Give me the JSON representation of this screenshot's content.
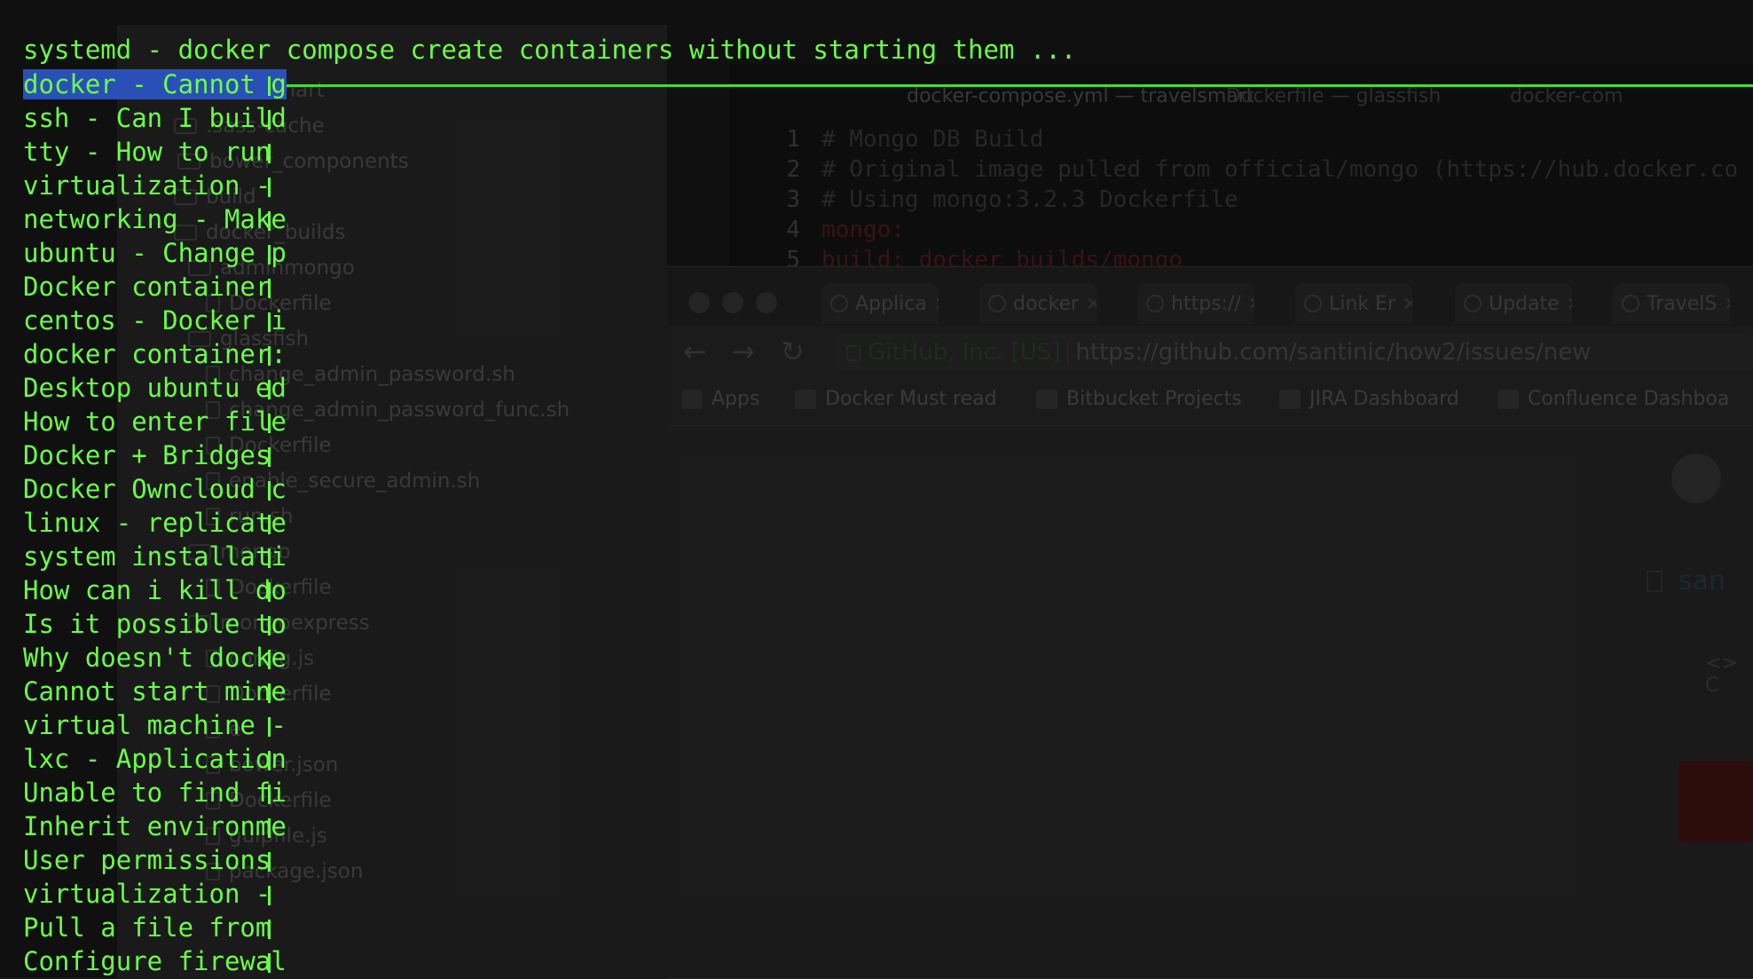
{
  "sidebar": {
    "items": [
      {
        "label": "travelsmart",
        "type": "folder"
      },
      {
        "label": ".sass-cache",
        "type": "folder"
      },
      {
        "label": "bower_components",
        "type": "folder"
      },
      {
        "label": "build",
        "type": "folder"
      },
      {
        "label": "docker_builds",
        "type": "folder"
      },
      {
        "label": "adminmongo",
        "type": "folder"
      },
      {
        "label": "Dockerfile",
        "type": "file"
      },
      {
        "label": "glassfish",
        "type": "folder"
      },
      {
        "label": "change_admin_password.sh",
        "type": "file"
      },
      {
        "label": "change_admin_password_func.sh",
        "type": "file"
      },
      {
        "label": "Dockerfile",
        "type": "file"
      },
      {
        "label": "enable_secure_admin.sh",
        "type": "file"
      },
      {
        "label": "run.sh",
        "type": "file"
      },
      {
        "label": "mongo",
        "type": "folder"
      },
      {
        "label": "Dockerfile",
        "type": "file"
      },
      {
        "label": "mongoexpress",
        "type": "folder"
      },
      {
        "label": "config.js",
        "type": "file"
      },
      {
        "label": "Dockerfile",
        "type": "file"
      },
      {
        "label": "e",
        "type": "file"
      },
      {
        "label": "bower.json",
        "type": "file"
      },
      {
        "label": "Dockerfile",
        "type": "file"
      },
      {
        "label": "gulpfile.js",
        "type": "file"
      },
      {
        "label": "package.json",
        "type": "file"
      }
    ]
  },
  "editor": {
    "tabs": [
      "docker-compose.yml — travelsmart",
      "Dockerfile — glassfish",
      "docker-com"
    ],
    "lines": [
      {
        "n": "1",
        "text": "# Mongo DB Build"
      },
      {
        "n": "2",
        "text": "# Original image pulled from official/mongo (https://hub.docker.co"
      },
      {
        "n": "3",
        "text": "# Using mongo:3.2.3 Dockerfile"
      },
      {
        "n": "4",
        "text": "mongo:"
      },
      {
        "n": "5",
        "text": "  build: docker_builds/mongo"
      }
    ]
  },
  "browser": {
    "tabs": [
      "Applica",
      "docker",
      "https://",
      "Link Er",
      "Update",
      "TravelS"
    ],
    "secure_label": "GitHub, Inc. [US]",
    "url_scheme": "https://",
    "url_host": "github.com",
    "url_path": "/santinic/how2/issues/new",
    "bookmarks": [
      "Apps",
      "Docker Must read",
      "Bitbucket Projects",
      "JIRA Dashboard",
      "Confluence Dashboa"
    ],
    "repo_fragment": "san",
    "code_fragment": "C"
  },
  "terminal": {
    "header": "systemd - docker compose create containers without starting them ...",
    "items": [
      "docker - Cannot g",
      "ssh - Can I build",
      "tty - How to run",
      "virtualization -",
      "networking - Make",
      "ubuntu - Change p",
      "Docker container",
      "centos - Docker i",
      "docker container:",
      "Desktop ubuntu ed",
      "How to enter file",
      "Docker + Bridges",
      "Docker Owncloud c",
      "linux - replicate",
      "system installati",
      "How can i kill do",
      "Is it possible to",
      "Why doesn't docke",
      "Cannot start mine",
      "virtual machine -",
      "lxc - Application",
      "Unable to find fi",
      "Inherit environme",
      "User permissions",
      "virtualization -",
      "Pull a file from",
      "Configure firewal"
    ],
    "selected_index": 0,
    "accent_color": "#6bff46",
    "selection_color": "#2a50b8"
  }
}
